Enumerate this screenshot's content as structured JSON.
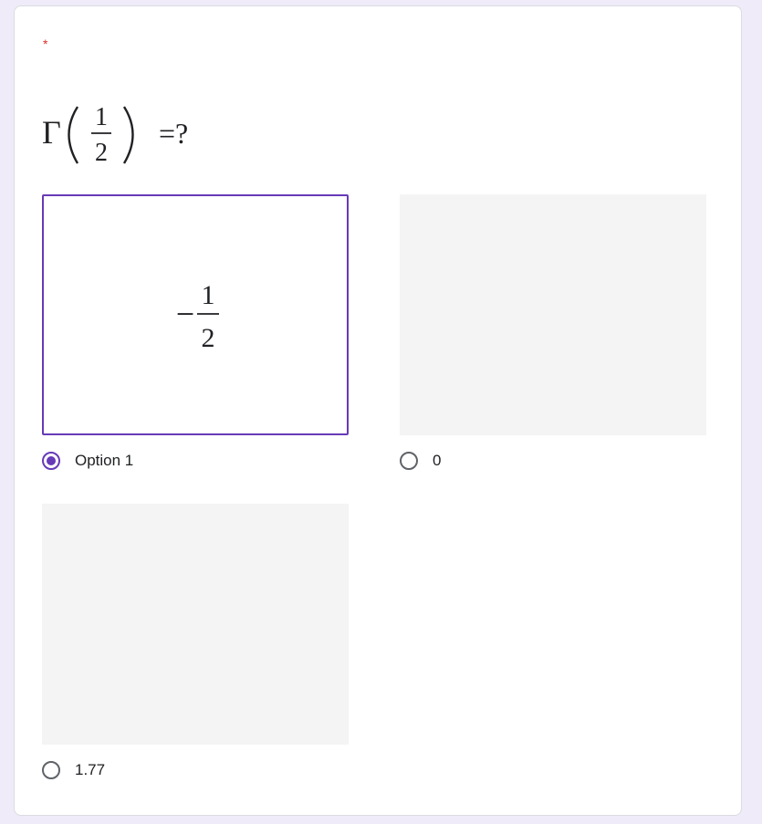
{
  "question": {
    "required_marker": "*",
    "formula": {
      "function": "Γ",
      "numerator": "1",
      "denominator": "2",
      "suffix": "=?"
    }
  },
  "options": [
    {
      "label": "Option 1",
      "selected": true,
      "image_formula": {
        "sign": "−",
        "numerator": "1",
        "denominator": "2"
      }
    },
    {
      "label": "0",
      "selected": false
    },
    {
      "label": "1.77",
      "selected": false
    }
  ],
  "colors": {
    "accent": "#673ab7",
    "required": "#d93025",
    "background": "#efebf8",
    "placeholder_image": "#f4f4f4"
  }
}
